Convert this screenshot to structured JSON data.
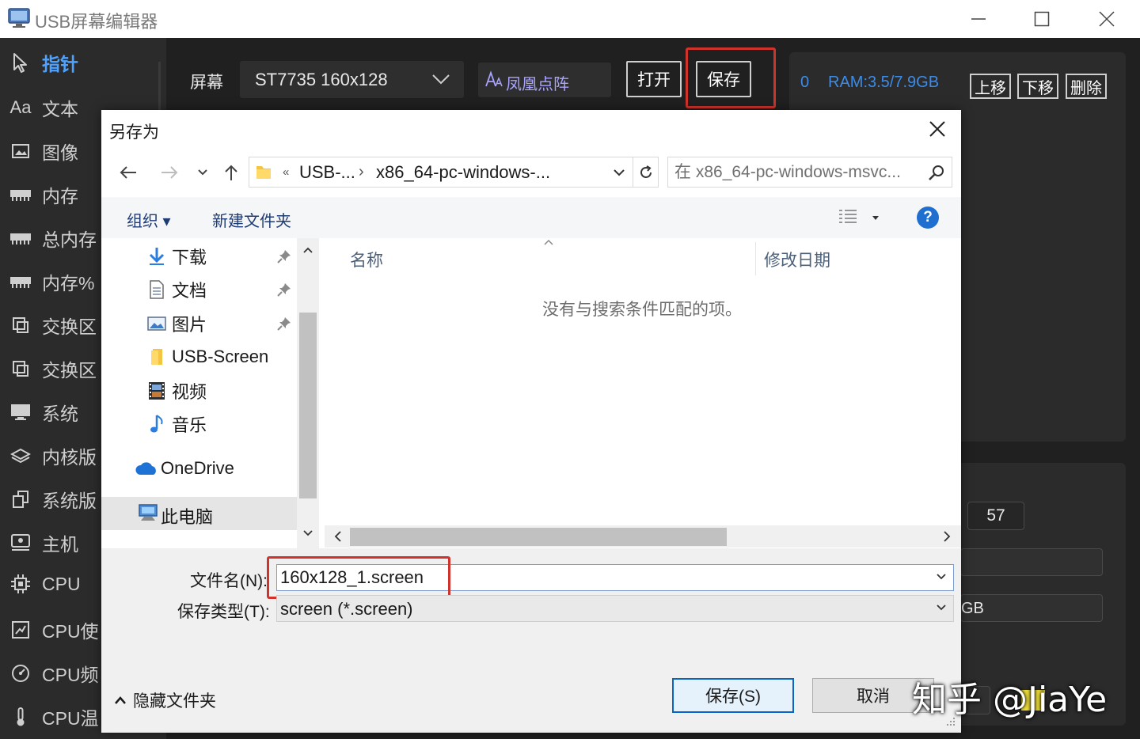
{
  "app": {
    "title": "USB屏幕编辑器"
  },
  "sidebar": {
    "items": [
      {
        "label": "指针",
        "icon": "pointer-icon"
      },
      {
        "label": "文本",
        "icon": "text-aa-icon"
      },
      {
        "label": "图像",
        "icon": "image-icon"
      },
      {
        "label": "内存",
        "icon": "memory-icon"
      },
      {
        "label": "总内存",
        "icon": "memory-icon"
      },
      {
        "label": "内存%",
        "icon": "memory-icon"
      },
      {
        "label": "交换区",
        "icon": "swap-icon"
      },
      {
        "label": "交换区",
        "icon": "swap-icon"
      },
      {
        "label": "系统",
        "icon": "monitor-icon"
      },
      {
        "label": "内核版",
        "icon": "layers-icon"
      },
      {
        "label": "系统版",
        "icon": "copy-icon"
      },
      {
        "label": "主机",
        "icon": "host-icon"
      },
      {
        "label": "CPU",
        "icon": "chip-icon"
      },
      {
        "label": "CPU使",
        "icon": "chart-icon"
      },
      {
        "label": "CPU频",
        "icon": "speed-icon"
      },
      {
        "label": "CPU温",
        "icon": "thermometer-icon"
      }
    ]
  },
  "toolbar": {
    "screen_label": "屏幕",
    "screen_value": "ST7735 160x128",
    "font_value": "凤凰点阵",
    "open_label": "打开",
    "save_label": "保存",
    "ram_count": "0",
    "ram_text": "RAM:3.5/7.9GB",
    "move_up_label": "上移",
    "move_down_label": "下移",
    "delete_label": "删除"
  },
  "right_panel": {
    "value": "57",
    "unit_fragment": "GB"
  },
  "dialog": {
    "title": "另存为",
    "breadcrumb": {
      "overflow": "«",
      "crumb1": "USB-...",
      "sep": "›",
      "crumb2": "x86_64-pc-windows-..."
    },
    "search_placeholder": "在 x86_64-pc-windows-msvc...",
    "organize_label": "组织 ▾",
    "new_folder_label": "新建文件夹",
    "help_label": "?",
    "nav": [
      {
        "label": "下载",
        "icon": "download-icon",
        "pinned": true
      },
      {
        "label": "文档",
        "icon": "document-icon",
        "pinned": true
      },
      {
        "label": "图片",
        "icon": "picture-icon",
        "pinned": true
      },
      {
        "label": "USB-Screen",
        "icon": "folder-icon",
        "pinned": false
      },
      {
        "label": "视频",
        "icon": "video-icon",
        "pinned": false
      },
      {
        "label": "音乐",
        "icon": "music-icon",
        "pinned": false
      },
      {
        "label": "OneDrive",
        "icon": "onedrive-icon",
        "pinned": false
      },
      {
        "label": "此电脑",
        "icon": "this-pc-icon",
        "pinned": false,
        "selected": true
      }
    ],
    "columns": {
      "name": "名称",
      "date": "修改日期"
    },
    "empty_message": "没有与搜索条件匹配的项。",
    "filename_label": "文件名(N):",
    "filename_value": "160x128_1.screen",
    "filetype_label": "保存类型(T):",
    "filetype_value": "screen (*.screen)",
    "hide_folders_label": "隐藏文件夹",
    "save_button": "保存(S)",
    "cancel_button": "取消"
  },
  "watermark": "知乎 @JiaYe",
  "colors": {
    "accent": "#3c8ce7",
    "highlight_red": "#d0332b",
    "sidebar_active": "#4da3ff",
    "dialog_button_border": "#0a64c4"
  }
}
